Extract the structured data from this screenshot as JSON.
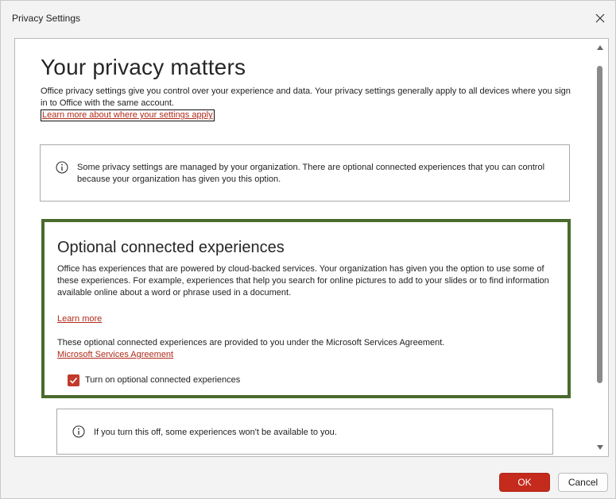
{
  "window": {
    "title": "Privacy Settings"
  },
  "main": {
    "heading": "Your privacy matters",
    "intro": "Office privacy settings give you control over your experience and data. Your privacy settings generally apply to all devices where you sign in to Office with the same account.",
    "learn_settings_link": "Learn more about where your settings apply",
    "org_notice": "Some privacy settings are managed by your organization. There are optional connected experiences that you can control because your organization has given you this option."
  },
  "optional": {
    "heading": "Optional connected experiences",
    "description": "Office has experiences that are powered by cloud-backed services. Your organization has given you the option to use some of these experiences. For example, experiences that help you search for online pictures to add to your slides or to find information available online about a word or phrase used in a document.",
    "learn_more": "Learn more",
    "agreement_text": "These optional connected experiences are provided to you under the Microsoft Services Agreement.",
    "agreement_link": "Microsoft Services Agreement",
    "checkbox_label": "Turn on optional connected experiences",
    "checkbox_checked": true,
    "off_notice": "If you turn this off, some experiences won't be available to you."
  },
  "buttons": {
    "ok": "OK",
    "cancel": "Cancel"
  },
  "colors": {
    "accent": "#c42b1c",
    "link": "#b02a1a",
    "highlight_border": "#4a6b2d"
  }
}
